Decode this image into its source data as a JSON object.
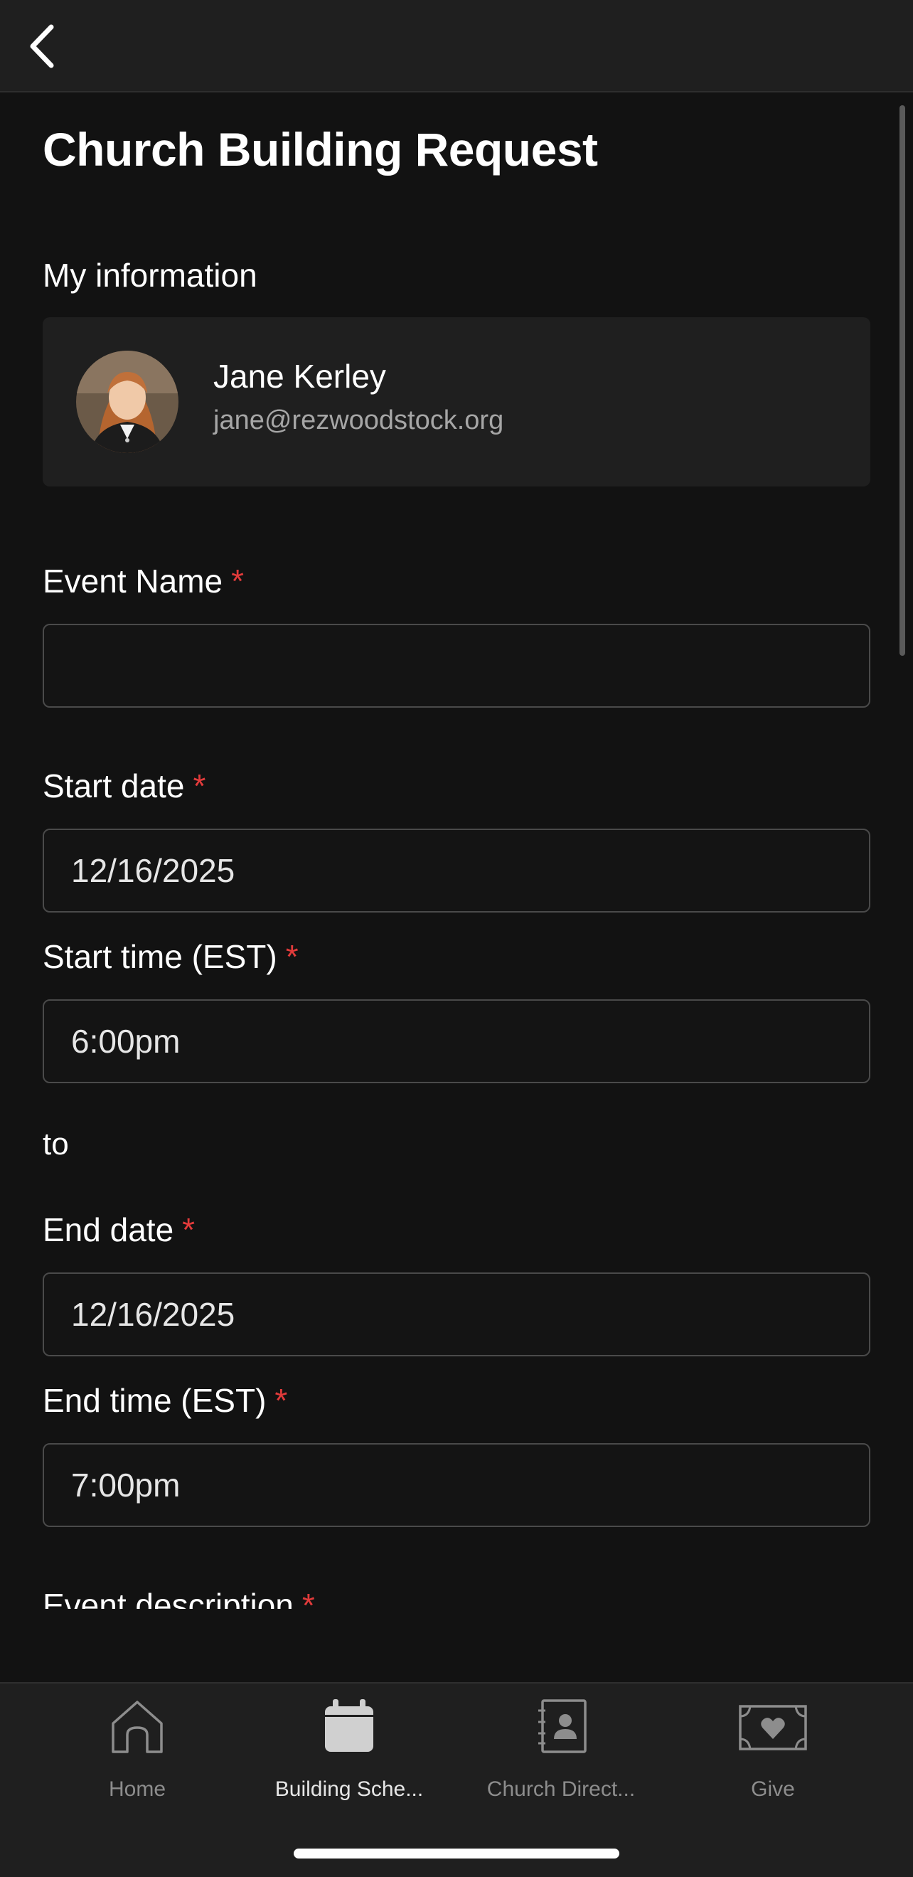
{
  "header": {
    "back_icon": "chevron-left-icon"
  },
  "page": {
    "title": "Church Building Request"
  },
  "my_info": {
    "label": "My information",
    "name": "Jane Kerley",
    "email": "jane@rezwoodstock.org"
  },
  "form": {
    "required_mark": "*",
    "event_name": {
      "label": "Event Name",
      "value": ""
    },
    "start_date": {
      "label": "Start date",
      "value": "12/16/2025"
    },
    "start_time": {
      "label": "Start time (EST)",
      "value": "6:00pm"
    },
    "separator": "to",
    "end_date": {
      "label": "End date",
      "value": "12/16/2025"
    },
    "end_time": {
      "label": "End time (EST)",
      "value": "7:00pm"
    },
    "event_description": {
      "label": "Event description"
    }
  },
  "tabbar": {
    "tabs": [
      {
        "label": "Home",
        "icon": "home-icon",
        "active": false
      },
      {
        "label": "Building Sche...",
        "icon": "calendar-icon",
        "active": true
      },
      {
        "label": "Church Direct...",
        "icon": "contacts-book-icon",
        "active": false
      },
      {
        "label": "Give",
        "icon": "money-heart-icon",
        "active": false
      }
    ]
  },
  "colors": {
    "background": "#121212",
    "surface": "#1f1f1f",
    "required": "#e23b3b",
    "inactive": "#8d8d8d"
  }
}
